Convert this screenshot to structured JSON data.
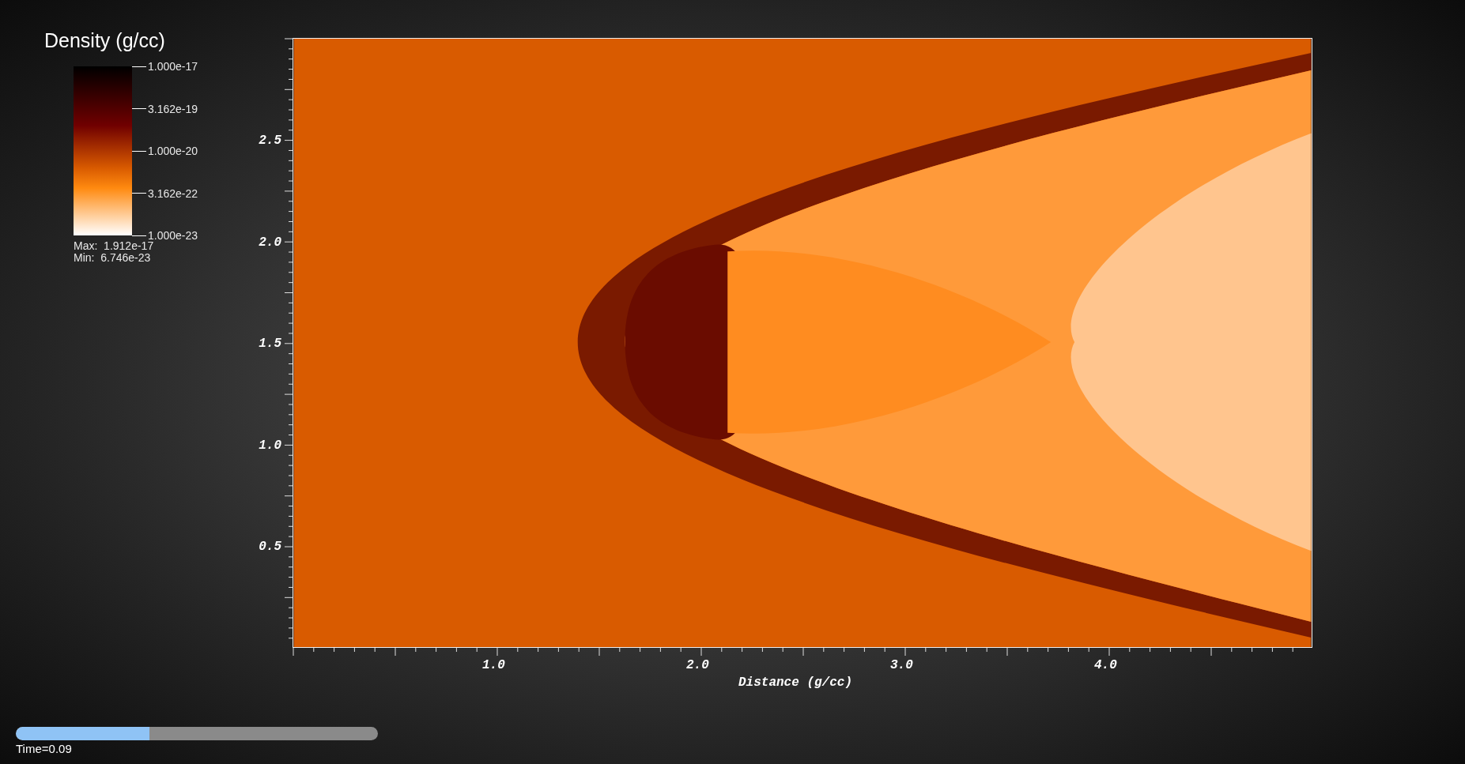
{
  "legend": {
    "title": "Density (g/cc)",
    "ticks": [
      "1.000e-17",
      "3.162e-19",
      "1.000e-20",
      "3.162e-22",
      "1.000e-23"
    ],
    "max": "Max:  1.912e-17",
    "min": "Min:  6.746e-23"
  },
  "plot": {
    "y_ticks": [
      "2.5",
      "2.0",
      "1.5",
      "1.0",
      "0.5"
    ],
    "x_ticks": [
      "1.0",
      "2.0",
      "3.0",
      "4.0"
    ],
    "xlabel": "Distance (g/cc)"
  },
  "time_slider": {
    "level": 0.37,
    "label": "Time=0.09"
  }
}
